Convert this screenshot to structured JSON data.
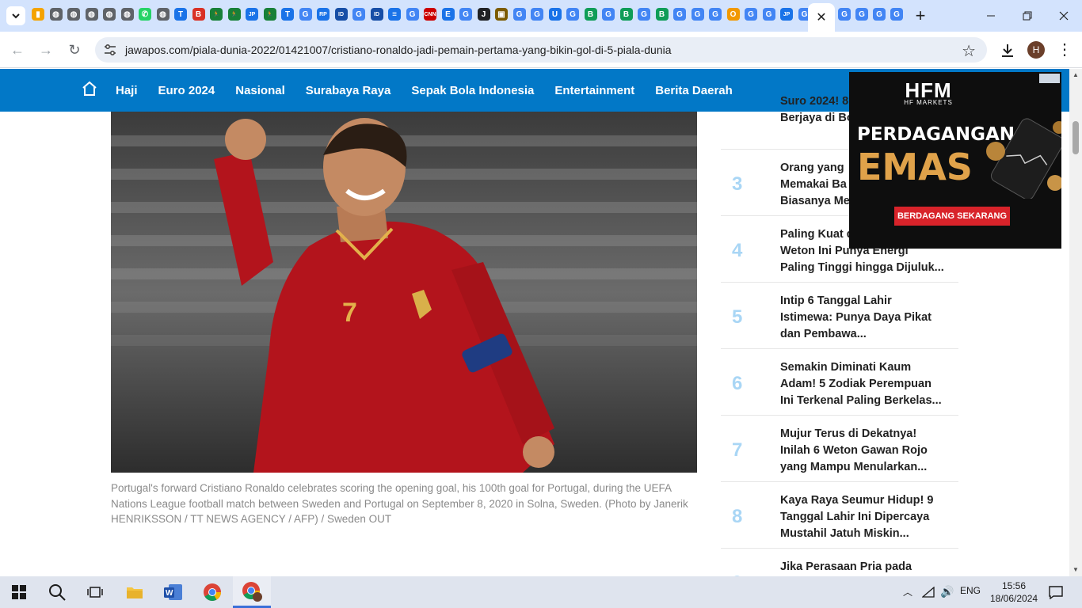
{
  "browser": {
    "tab_favicons": [
      {
        "icon": "sheets-icon",
        "color": "#f4a300",
        "glyph": "▮"
      },
      {
        "icon": "globe-icon",
        "color": "#5f6368",
        "glyph": "◍"
      },
      {
        "icon": "globe-icon",
        "color": "#5f6368",
        "glyph": "◍"
      },
      {
        "icon": "globe-icon",
        "color": "#5f6368",
        "glyph": "◍"
      },
      {
        "icon": "globe-icon",
        "color": "#5f6368",
        "glyph": "◍"
      },
      {
        "icon": "globe-icon",
        "color": "#5f6368",
        "glyph": "◍"
      },
      {
        "icon": "whatsapp-icon",
        "color": "#25d366",
        "glyph": "✆"
      },
      {
        "icon": "globe-icon",
        "color": "#5f6368",
        "glyph": "◍"
      },
      {
        "icon": "site-icon",
        "color": "#1a73e8",
        "glyph": "T"
      },
      {
        "icon": "site-icon",
        "color": "#d93025",
        "glyph": "B"
      },
      {
        "icon": "runner-icon",
        "color": "#188038",
        "glyph": "🏃"
      },
      {
        "icon": "runner-icon",
        "color": "#188038",
        "glyph": "🏃"
      },
      {
        "icon": "jp-icon",
        "color": "#1a73e8",
        "glyph": "JP"
      },
      {
        "icon": "runner-icon",
        "color": "#188038",
        "glyph": "🏃"
      },
      {
        "icon": "site-icon",
        "color": "#1a73e8",
        "glyph": "T"
      },
      {
        "icon": "google-icon",
        "color": "#4285f4",
        "glyph": "G"
      },
      {
        "icon": "rp-icon",
        "color": "#1a73e8",
        "glyph": "RP"
      },
      {
        "icon": "site-icon",
        "color": "#174ea6",
        "glyph": "ID"
      },
      {
        "icon": "google-icon",
        "color": "#4285f4",
        "glyph": "G"
      },
      {
        "icon": "site-icon",
        "color": "#174ea6",
        "glyph": "ID"
      },
      {
        "icon": "docs-icon",
        "color": "#1a73e8",
        "glyph": "≡"
      },
      {
        "icon": "google-icon",
        "color": "#4285f4",
        "glyph": "G"
      },
      {
        "icon": "cnn-icon",
        "color": "#cc0000",
        "glyph": "CNN"
      },
      {
        "icon": "site-icon",
        "color": "#1a73e8",
        "glyph": "E"
      },
      {
        "icon": "google-icon",
        "color": "#4285f4",
        "glyph": "G"
      },
      {
        "icon": "site-icon",
        "color": "#202124",
        "glyph": "J"
      },
      {
        "icon": "site-icon",
        "color": "#7c5b00",
        "glyph": "▣"
      },
      {
        "icon": "google-icon",
        "color": "#4285f4",
        "glyph": "G"
      },
      {
        "icon": "google-icon",
        "color": "#4285f4",
        "glyph": "G"
      },
      {
        "icon": "site-icon",
        "color": "#1a73e8",
        "glyph": "U"
      },
      {
        "icon": "google-icon",
        "color": "#4285f4",
        "glyph": "G"
      },
      {
        "icon": "site-icon",
        "color": "#0f9d58",
        "glyph": "B"
      },
      {
        "icon": "google-icon",
        "color": "#4285f4",
        "glyph": "G"
      },
      {
        "icon": "site-icon",
        "color": "#0f9d58",
        "glyph": "B"
      },
      {
        "icon": "google-icon",
        "color": "#4285f4",
        "glyph": "G"
      },
      {
        "icon": "site-icon",
        "color": "#0f9d58",
        "glyph": "B"
      },
      {
        "icon": "google-icon",
        "color": "#4285f4",
        "glyph": "G"
      },
      {
        "icon": "google-icon",
        "color": "#4285f4",
        "glyph": "G"
      },
      {
        "icon": "google-icon",
        "color": "#4285f4",
        "glyph": "G"
      },
      {
        "icon": "site-icon",
        "color": "#f29900",
        "glyph": "O"
      },
      {
        "icon": "google-icon",
        "color": "#4285f4",
        "glyph": "G"
      },
      {
        "icon": "google-icon",
        "color": "#4285f4",
        "glyph": "G"
      },
      {
        "icon": "jp-icon",
        "color": "#1a73e8",
        "glyph": "JP"
      },
      {
        "icon": "google-icon",
        "color": "#4285f4",
        "glyph": "G"
      }
    ],
    "after_tabs_favicons": [
      "G",
      "G",
      "G",
      "G"
    ],
    "url": "jawapos.com/piala-dunia-2022/01421007/cristiano-ronaldo-jadi-pemain-pertama-yang-bikin-gol-di-5-piala-dunia",
    "avatar_letter": "H"
  },
  "site": {
    "accent": "#0278c7",
    "nav": [
      "Haji",
      "Euro 2024",
      "Nasional",
      "Surabaya Raya",
      "Sepak Bola Indonesia",
      "Entertainment",
      "Berita Daerah"
    ]
  },
  "article": {
    "caption": "Portugal's forward Cristiano Ronaldo celebrates scoring the opening goal, his 100th goal for Portugal, during the UEFA Nations League football match between Sweden and Portugal on September 8, 2020 in Solna, Sweden. (Photo by Janerik HENRIKSSON / TT NEWS AGENCY / AFP) / Sweden OUT"
  },
  "popular": [
    {
      "num": "",
      "title": "Suro 2024! 8\nBerjaya di Bo"
    },
    {
      "num": "3",
      "title": "Orang yang\nMemakai Ba\nBiasanya Me"
    },
    {
      "num": "4",
      "title": "Paling Kuat d\nWeton Ini Punya Energi\nPaling Tinggi hingga Dijuluk..."
    },
    {
      "num": "5",
      "title": "Intip 6 Tanggal Lahir\nIstimewa: Punya Daya Pikat\ndan Pembawa..."
    },
    {
      "num": "6",
      "title": "Semakin Diminati Kaum\nAdam! 5 Zodiak Perempuan\nIni Terkenal Paling Berkelas..."
    },
    {
      "num": "7",
      "title": "Mujur Terus di Dekatnya!\nInilah 6 Weton Gawan Rojo\nyang Mampu Menularkan..."
    },
    {
      "num": "8",
      "title": "Kaya Raya Seumur Hidup! 9\nTanggal Lahir Ini Dipercaya\nMustahil Jatuh Miskin..."
    },
    {
      "num": "9",
      "title": "Jika Perasaan Pria pada"
    }
  ],
  "ad": {
    "logo": "HFM",
    "logo_sub": "HF MARKETS",
    "headline_1": "PERDAGANGAN",
    "headline_2": "EMAS",
    "cta": "BERDAGANG SEKARANG"
  },
  "taskbar": {
    "lang": "ENG",
    "time": "15:56",
    "date": "18/06/2024"
  }
}
